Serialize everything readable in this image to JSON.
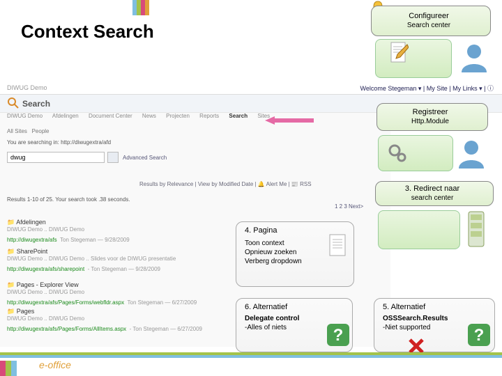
{
  "title": "Context Search",
  "spTopbar": {
    "demoSite": "DIWUG Demo",
    "welcome": "Welcome",
    "user": "Stegeman ▾",
    "mySite": "My Site",
    "myLinks": "My Links ▾"
  },
  "spHeader": {
    "label": "Search"
  },
  "spNav": {
    "items": [
      "DIWUG Demo",
      "Afdelingen",
      "Document Center",
      "News",
      "Projecten",
      "Reports",
      "Search",
      "Sites"
    ]
  },
  "spTabs": {
    "allSites": "All Sites",
    "people": "People"
  },
  "searchingIn": "You are searching in: http://diwugextra/afd",
  "searchValue": "dwug",
  "advanced": "Advanced Search",
  "resultBar": "Results by Relevance | View by Modified Date | 🔔 Alert Me | 📰 RSS",
  "resultCount": "Results 1-10 of 25. Your search took .38 seconds.",
  "paging": "1  2  3  Next>",
  "results": [
    {
      "name": "Afdelingen",
      "line2": "DIWUG Demo .. DIWUG Demo",
      "url": "http://diwugextra/afs",
      "by": "Ton Stegeman — 9/28/2009"
    },
    {
      "name": "SharePoint",
      "line2": "DIWUG Demo .. DIWUG Demo .. Slides voor de DIWUG presentatie",
      "url": "http://diwugextra/afs/sharepoint",
      "by": "- Ton Stegeman — 9/28/2009"
    },
    {
      "name": "Pages - Explorer View",
      "line2": "DIWUG Demo .. DIWUG Demo",
      "url": "http://diwugextra/afs/Pages/Forms/webfldr.aspx",
      "by": "Ton Stegeman — 6/27/2009"
    },
    {
      "name": "Pages",
      "line2": "DIWUG Demo .. DIWUG Demo",
      "url": "http://diwugextra/afs/Pages/Forms/AllItems.aspx",
      "by": "- Ton Stegeman — 6/27/2009"
    }
  ],
  "callouts": {
    "config": {
      "head": "Configureer",
      "sub": "Search center"
    },
    "reg": {
      "head": "Registreer",
      "sub": "Http.Module"
    },
    "redir": {
      "head": "3. Redirect naar",
      "sub": "search center"
    },
    "page": {
      "head": "4. Pagina",
      "l1": "Toon context",
      "l2": "Opnieuw zoeken",
      "l3": "Verberg dropdown"
    },
    "alt6": {
      "head": "6. Alternatief",
      "b1": "Delegate control",
      "b2": "-Alles of niets"
    },
    "alt5": {
      "head": "5. Alternatief",
      "b1": "OSSSearch.Results",
      "b2": "-Niet supported"
    }
  },
  "logo": "e-office"
}
